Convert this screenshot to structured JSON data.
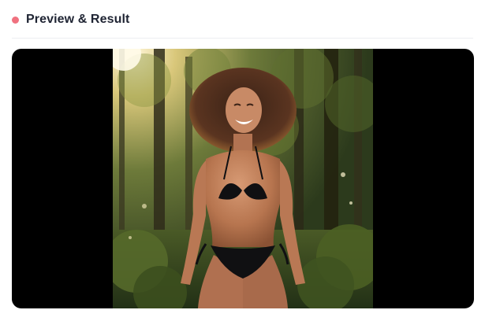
{
  "section": {
    "title": "Preview & Result",
    "status_dot_color": "#f0717f"
  },
  "preview": {
    "background_color": "#000000",
    "image_description_icon": "result-image"
  }
}
